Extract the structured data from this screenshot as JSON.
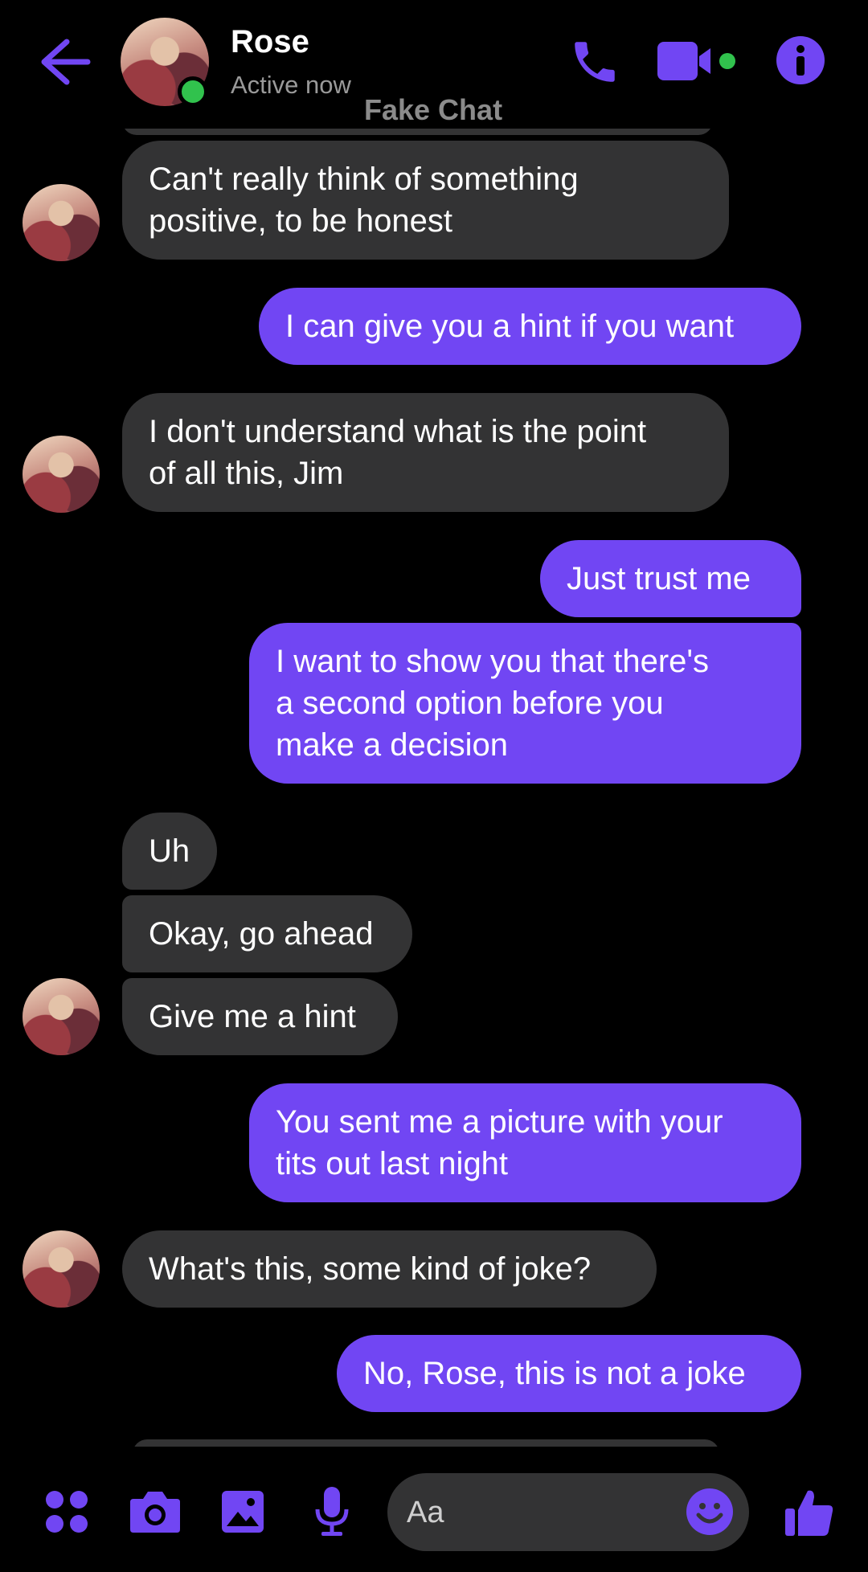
{
  "header": {
    "contact_name": "Rose",
    "status": "Active now",
    "watermark": "Fake Chat"
  },
  "colors": {
    "accent": "#7146f3",
    "received_bubble": "#333334",
    "online": "#31c24d",
    "background": "#000000"
  },
  "messages": [
    {
      "from": "contact",
      "text": "Can't really think of something\npositive, to be honest"
    },
    {
      "from": "me",
      "text": "I can give you a hint if you want"
    },
    {
      "from": "contact",
      "text": "I don't understand what is the point\nof all this, Jim"
    },
    {
      "from": "me",
      "text": "Just trust me"
    },
    {
      "from": "me",
      "text": "I want to show you that there's\na second option before you\nmake a decision"
    },
    {
      "from": "contact",
      "text": "Uh"
    },
    {
      "from": "contact",
      "text": "Okay, go ahead"
    },
    {
      "from": "contact",
      "text": "Give me a hint"
    },
    {
      "from": "me",
      "text": "You sent me a picture with your\ntits out last night"
    },
    {
      "from": "contact",
      "text": "What's this, some kind of joke?"
    },
    {
      "from": "me",
      "text": "No, Rose, this is not a joke"
    }
  ],
  "composer": {
    "placeholder": "Aa",
    "icons": [
      "apps-icon",
      "camera-icon",
      "gallery-icon",
      "microphone-icon",
      "emoji-icon",
      "thumbs-up-icon"
    ]
  }
}
